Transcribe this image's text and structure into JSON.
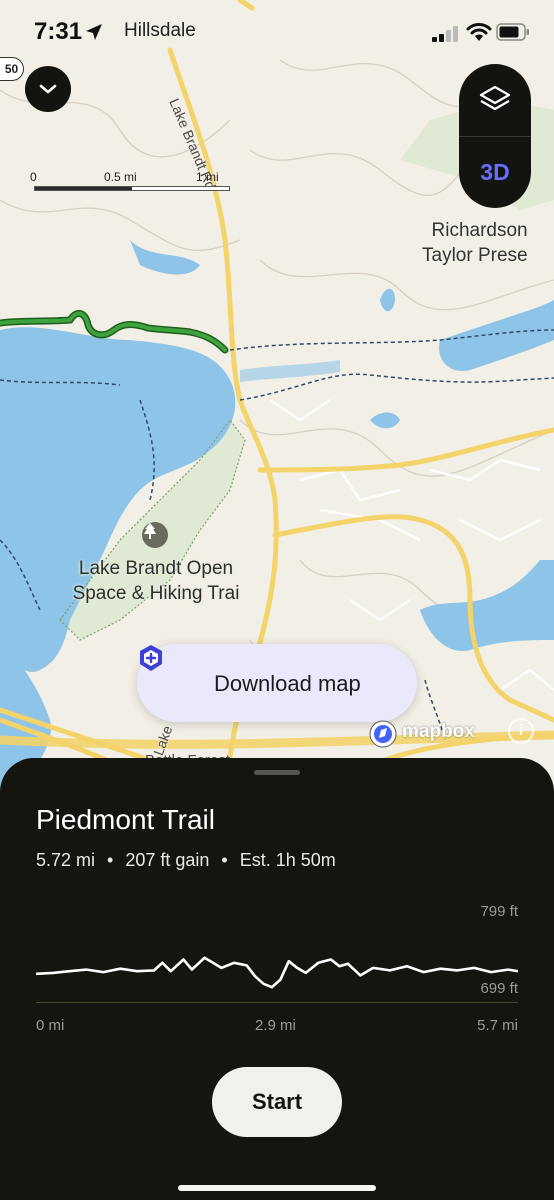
{
  "status_bar": {
    "time": "7:31",
    "location": "Hillsdale"
  },
  "map": {
    "route_badge": "50",
    "scale": {
      "labels": [
        "0",
        "0.5 mi",
        "1 mi"
      ]
    },
    "controls": {
      "three_d_label": "3D"
    },
    "labels": {
      "road": "Lake Brandt Rd",
      "park_line1": "Lake Brandt Open",
      "park_line2": "Space & Hiking Trai",
      "preserve_line1": "Richardson",
      "preserve_line2": "Taylor Prese",
      "lower_road": "Lake",
      "lower_road2": "Battle Forest"
    },
    "download_button": "Download map",
    "attribution": "mapbox",
    "colors": {
      "trail": "#3da33d",
      "water": "#8ec4e8",
      "park": "#dfe9d3",
      "road": "#f3d36a"
    }
  },
  "sheet": {
    "trail_name": "Piedmont Trail",
    "distance": "5.72 mi",
    "gain": "207 ft gain",
    "estimate": "Est. 1h 50m",
    "separator": "•",
    "elevation_max": "799 ft",
    "elevation_min": "699 ft",
    "distance_ticks": [
      "0 mi",
      "2.9 mi",
      "5.7 mi"
    ],
    "start_button": "Start"
  },
  "chart_data": {
    "type": "line",
    "title": "",
    "xlabel": "",
    "ylabel": "",
    "xlim": [
      0,
      5.72
    ],
    "ylim": [
      699,
      799
    ],
    "x_ticks": [
      "0 mi",
      "2.9 mi",
      "5.7 mi"
    ],
    "y_ticks": [
      "699 ft",
      "799 ft"
    ],
    "series": [
      {
        "x": [
          0,
          0.2,
          0.4,
          0.6,
          0.8,
          1.0,
          1.2,
          1.4,
          1.5,
          1.6,
          1.75,
          1.85,
          2.0,
          2.1,
          2.2,
          2.35,
          2.5,
          2.6,
          2.7,
          2.8,
          2.9,
          3.0,
          3.1,
          3.2,
          3.35,
          3.5,
          3.6,
          3.7,
          3.85,
          4.0,
          4.2,
          4.4,
          4.6,
          4.8,
          5.0,
          5.2,
          5.4,
          5.6,
          5.72
        ],
        "y": [
          735,
          736,
          738,
          740,
          737,
          741,
          738,
          739,
          748,
          738,
          752,
          740,
          754,
          748,
          742,
          748,
          745,
          732,
          723,
          719,
          728,
          750,
          742,
          736,
          748,
          752,
          744,
          747,
          733,
          742,
          739,
          744,
          737,
          741,
          739,
          742,
          737,
          740,
          738
        ]
      }
    ]
  }
}
